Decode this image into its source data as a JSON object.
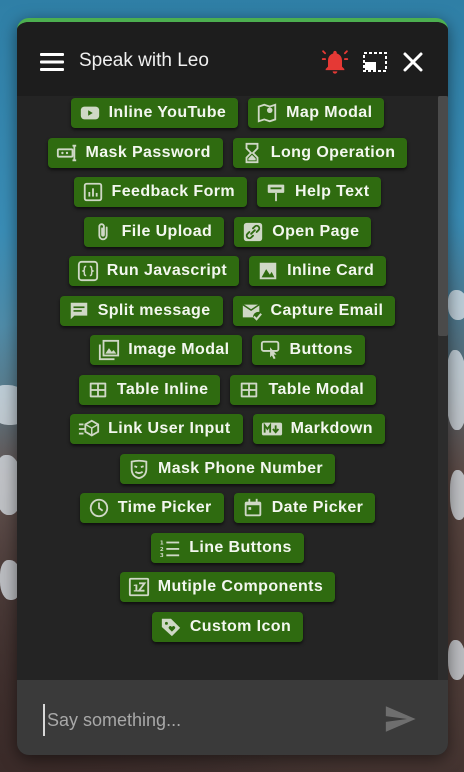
{
  "colors": {
    "accent": "#4caf50",
    "chip_bg": "#2f6b10",
    "chip_text": "#f3f7ef",
    "bell": "#e53935",
    "header_bg": "#1d1d1d",
    "window_bg": "#242424",
    "input_bg": "#3a3a3a"
  },
  "header": {
    "title": "Speak with Leo",
    "menu_icon": "hamburger-icon",
    "notification_icon": "bell-icon",
    "minimize_icon": "minimize-window-icon",
    "close_icon": "close-icon"
  },
  "rows": [
    [
      {
        "label": "Inline YouTube",
        "icon": "youtube-icon"
      },
      {
        "label": "Map Modal",
        "icon": "map-icon"
      }
    ],
    [
      {
        "label": "Mask Password",
        "icon": "password-icon"
      },
      {
        "label": "Long Operation",
        "icon": "hourglass-icon"
      }
    ],
    [
      {
        "label": "Feedback Form",
        "icon": "bar-chart-icon"
      },
      {
        "label": "Help Text",
        "icon": "signpost-icon"
      }
    ],
    [
      {
        "label": "File Upload",
        "icon": "paperclip-icon"
      },
      {
        "label": "Open Page",
        "icon": "link-icon"
      }
    ],
    [
      {
        "label": "Run Javascript",
        "icon": "code-braces-icon"
      },
      {
        "label": "Inline Card",
        "icon": "image-card-icon"
      }
    ],
    [
      {
        "label": "Split message",
        "icon": "message-icon"
      },
      {
        "label": "Capture Email",
        "icon": "email-check-icon"
      }
    ],
    [
      {
        "label": "Image Modal",
        "icon": "images-icon"
      },
      {
        "label": "Buttons",
        "icon": "touch-button-icon"
      }
    ],
    [
      {
        "label": "Table Inline",
        "icon": "table-icon"
      },
      {
        "label": "Table Modal",
        "icon": "table-icon"
      }
    ],
    [
      {
        "label": "Link User Input",
        "icon": "link-input-icon"
      },
      {
        "label": "Markdown",
        "icon": "markdown-icon"
      }
    ],
    [
      {
        "label": "Mask Phone Number",
        "icon": "mask-icon"
      }
    ],
    [
      {
        "label": "Time Picker",
        "icon": "clock-icon"
      },
      {
        "label": "Date Picker",
        "icon": "calendar-icon"
      }
    ],
    [
      {
        "label": "Line Buttons",
        "icon": "numbered-list-icon"
      }
    ],
    [
      {
        "label": "Mutiple Components",
        "icon": "numeric-icon"
      }
    ],
    [
      {
        "label": "Custom Icon",
        "icon": "tag-heart-icon"
      }
    ]
  ],
  "input": {
    "placeholder": "Say something...",
    "value": "",
    "send_icon": "send-icon"
  }
}
